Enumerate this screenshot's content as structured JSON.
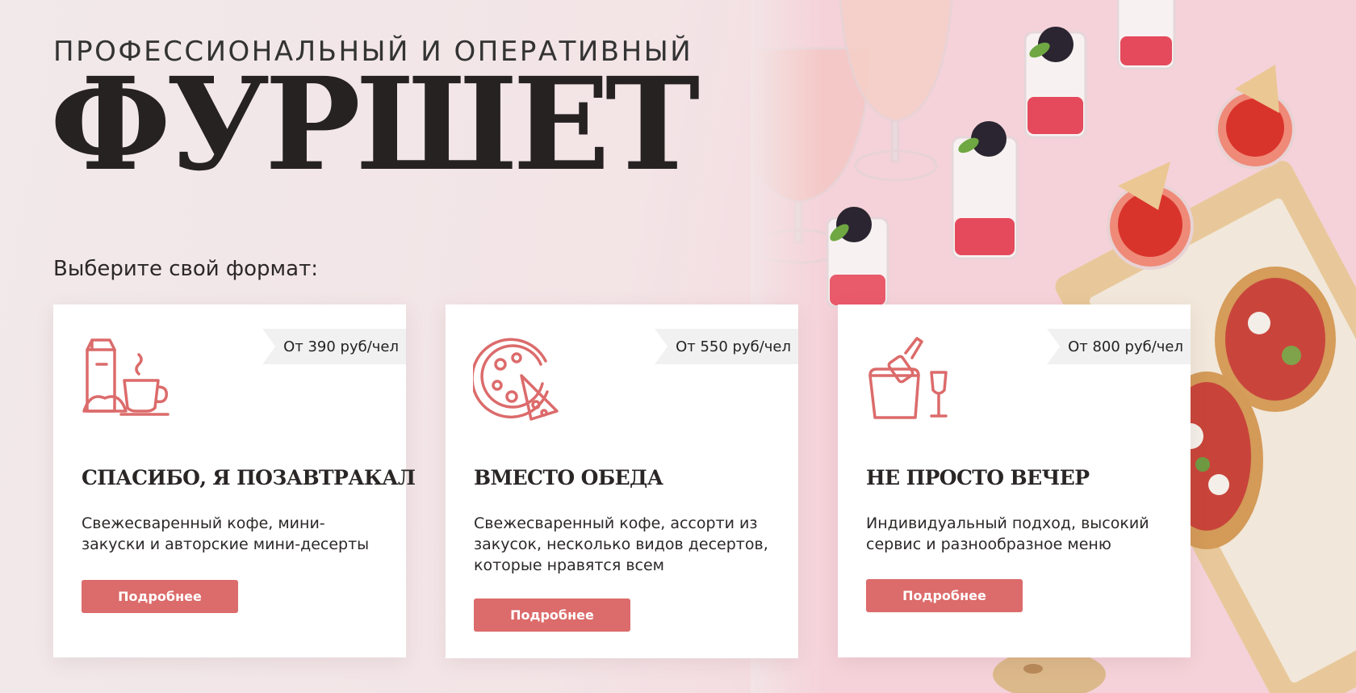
{
  "hero": {
    "subtitle": "ПРОФЕССИОНАЛЬНЫЙ И ОПЕРАТИВНЫЙ",
    "title": "ФУРШЕТ"
  },
  "choose_label": "Выберите свой формат:",
  "accent_color": "#dc6b6b",
  "cards": [
    {
      "icon": "breakfast-icon",
      "price": "От 390 руб/чел",
      "title": "СПАСИБО, Я ПОЗАВТРАКАЛ",
      "description": "Свежесваренный кофе, мини-закуски и авторские мини-десерты",
      "button": "Подробнее"
    },
    {
      "icon": "pizza-icon",
      "price": "От 550 руб/чел",
      "title": "ВМЕСТО ОБЕДА",
      "description": "Свежесваренный кофе, ассорти из закусок, несколько видов десертов, которые нравятся всем",
      "button": "Подробнее"
    },
    {
      "icon": "champagne-bucket-icon",
      "price": "От 800 руб/чел",
      "title": "НЕ ПРОСТО ВЕЧЕР",
      "description": "Индивидуальный подход, высокий сервис и разнообразное меню",
      "button": "Подробнее"
    }
  ]
}
